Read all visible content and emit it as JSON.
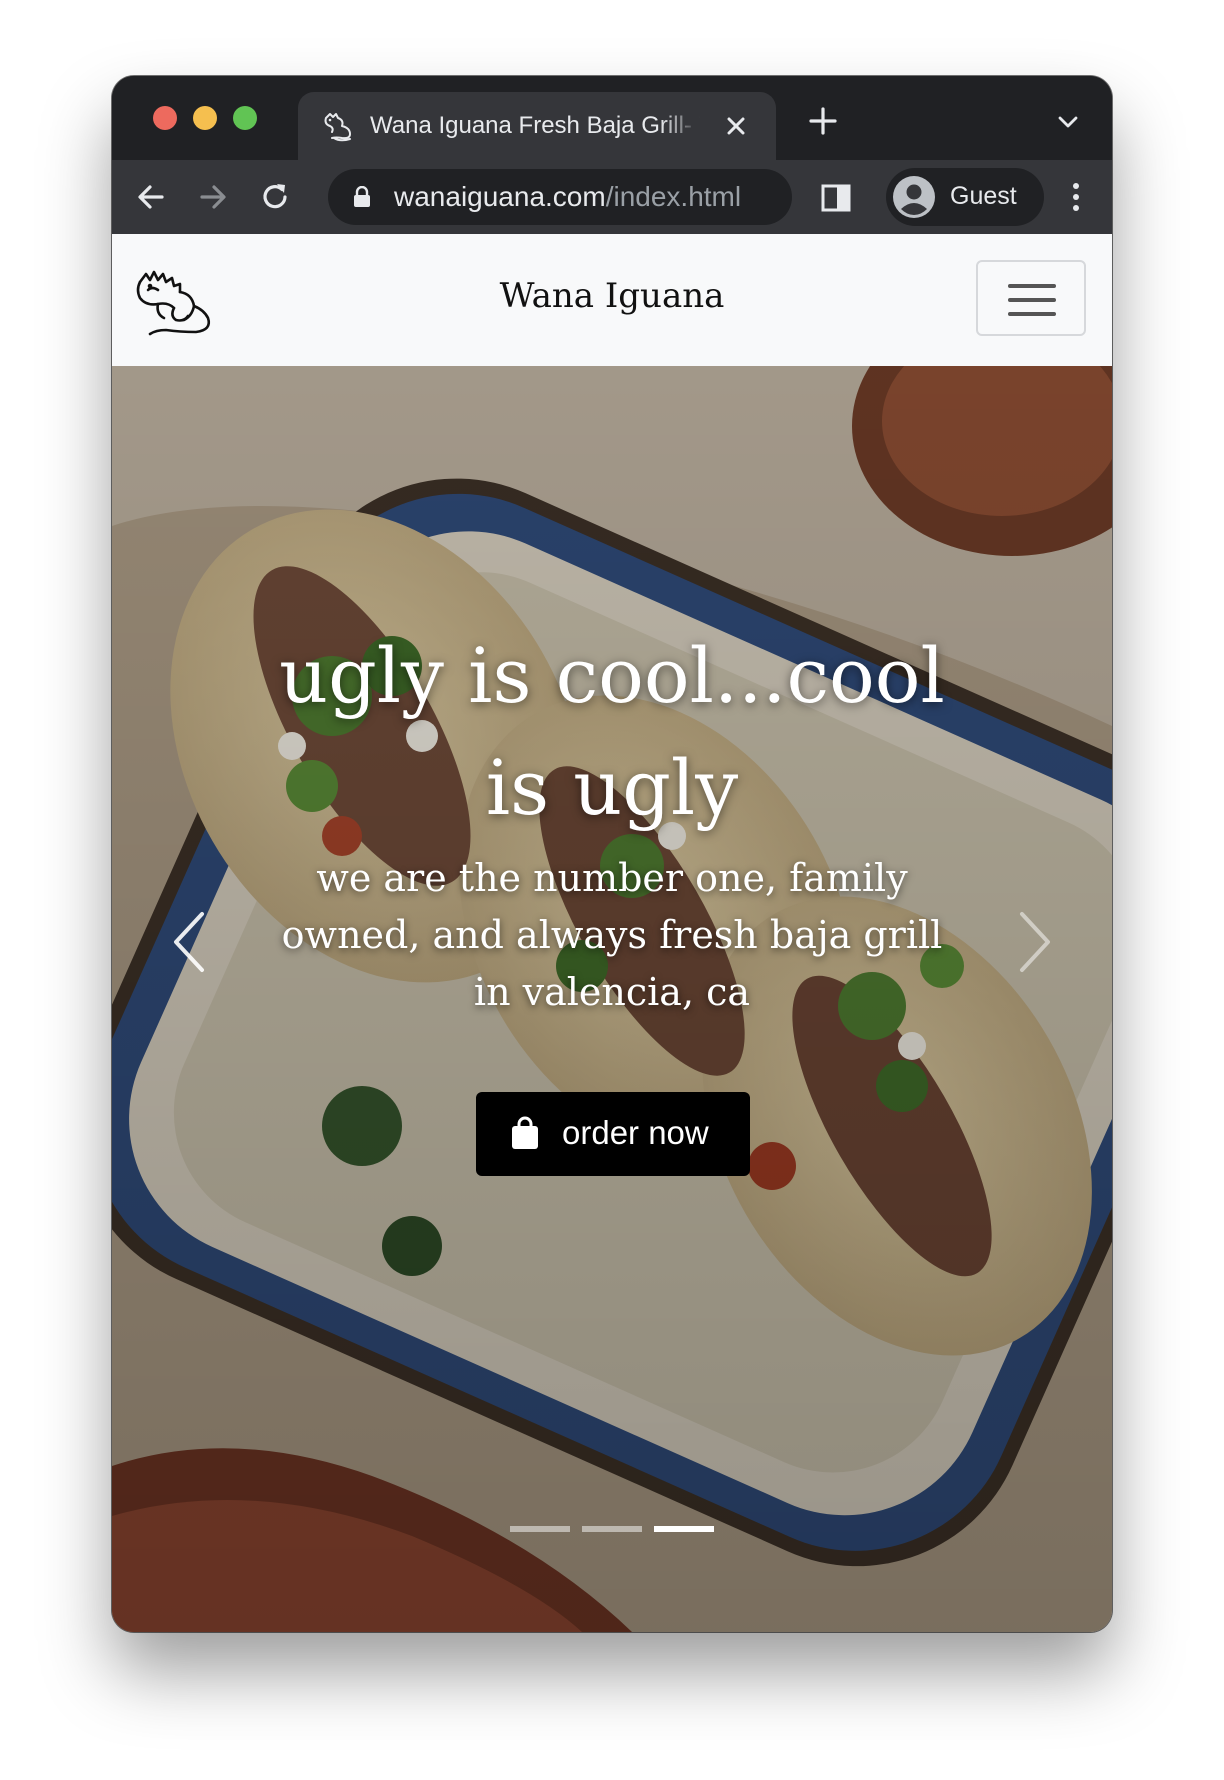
{
  "browser": {
    "tab_title": "Wana Iguana Fresh Baja Grill- V",
    "url_host": "wanaiguana.com",
    "url_path": "/index.html",
    "profile_name": "Guest"
  },
  "site": {
    "brand": "Wana Iguana"
  },
  "hero": {
    "headline": "ugly is cool...cool is ugly",
    "subline": "we are the number one, family owned, and always fresh baja grill in valencia, ca",
    "cta_label": "order now",
    "slides_total": 3,
    "active_slide": 3
  }
}
